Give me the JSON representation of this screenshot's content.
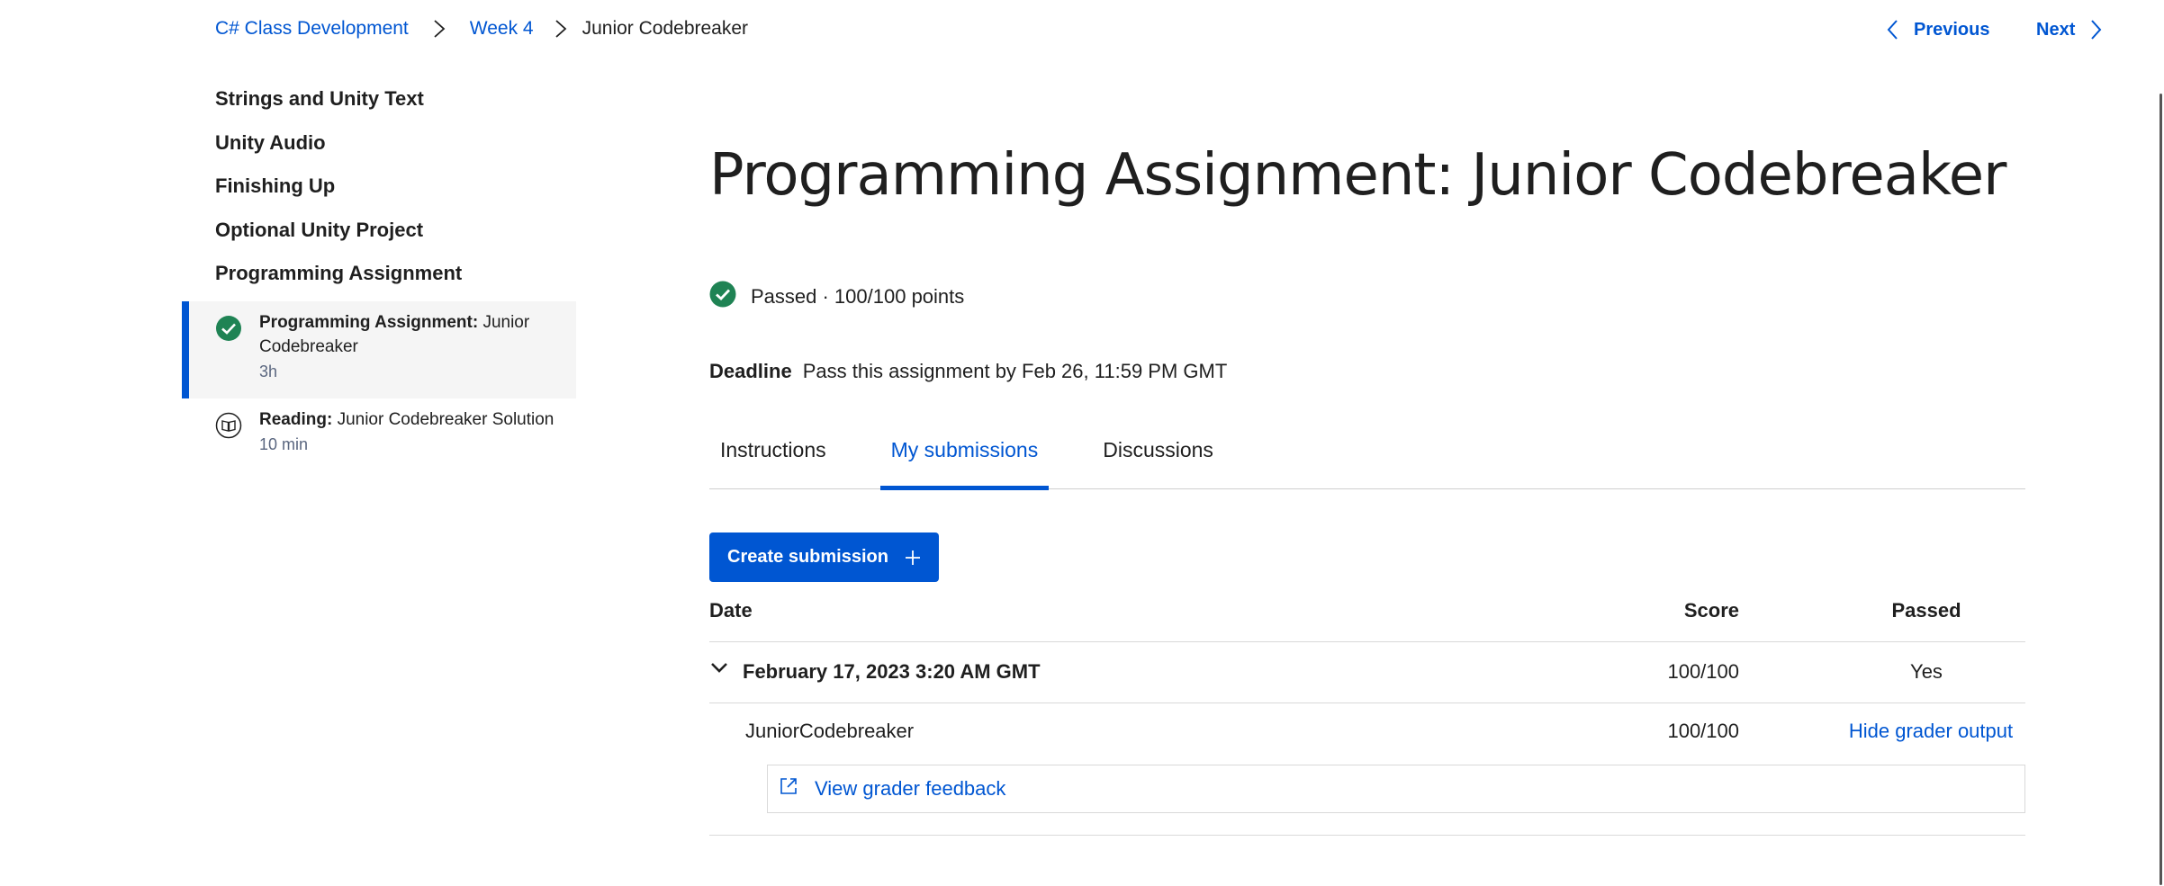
{
  "breadcrumb": {
    "items": [
      "C# Class Development",
      "Week 4",
      "Junior Codebreaker"
    ]
  },
  "pager": {
    "previous_label": "Previous",
    "next_label": "Next"
  },
  "sidebar": {
    "sections": [
      "Strings and Unity Text",
      "Unity Audio",
      "Finishing Up",
      "Optional Unity Project",
      "Programming Assignment"
    ],
    "items": [
      {
        "kind": "Programming Assignment:",
        "title": "Junior Codebreaker",
        "meta": "3h",
        "icon": "completed-check-icon",
        "active": true
      },
      {
        "kind": "Reading:",
        "title": "Junior Codebreaker Solution",
        "meta": "10 min",
        "icon": "reading-book-icon",
        "active": false
      }
    ]
  },
  "main": {
    "title": "Programming Assignment: Junior Codebreaker",
    "status": "Passed · 100/100 points",
    "deadline_label": "Deadline",
    "deadline_text": "Pass this assignment by Feb 26, 11:59 PM GMT",
    "tabs": [
      "Instructions",
      "My submissions",
      "Discussions"
    ],
    "active_tab": "My submissions",
    "create_button": "Create submission",
    "table": {
      "headers": {
        "date": "Date",
        "score": "Score",
        "passed": "Passed"
      },
      "submission": {
        "date": "February 17, 2023 3:20 AM GMT",
        "score": "100/100",
        "passed": "Yes"
      },
      "part": {
        "name": "JuniorCodebreaker",
        "score": "100/100",
        "action": "Hide grader output"
      },
      "feedback_link": "View grader feedback"
    }
  },
  "colors": {
    "accent": "#0056d2",
    "success": "#1f8354",
    "text": "#1f1f1f",
    "muted": "#5b6780"
  }
}
